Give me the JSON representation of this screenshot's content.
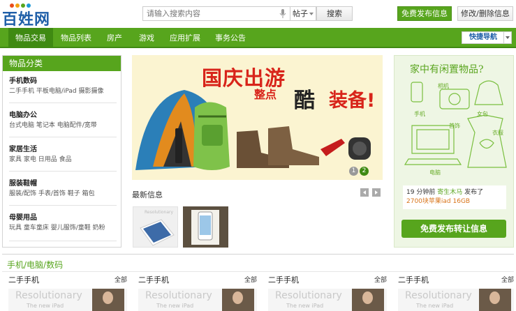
{
  "header": {
    "logo": "百姓网",
    "search_placeholder": "请输入搜索内容",
    "search_scope": "帖子",
    "search_button": "搜索",
    "post_button": "免费发布信息",
    "edit_button": "修改/删除信息"
  },
  "nav": {
    "items": [
      "物品交易",
      "物品列表",
      "房产",
      "游戏",
      "应用扩展",
      "事务公告"
    ],
    "quick_nav": "快捷导航"
  },
  "sidebar": {
    "title": "物品分类",
    "categories": [
      {
        "title": "手机数码",
        "items": "二手手机 平板电脑/iPad 摄影摄像"
      },
      {
        "title": "电脑办公",
        "items": "台式电脑 笔记本 电脑配件/宽带"
      },
      {
        "title": "家居生活",
        "items": "家具 家电 日用品 食品"
      },
      {
        "title": "服装鞋帽",
        "items": "服装/配饰 手表/首饰 鞋子 箱包"
      },
      {
        "title": "母婴用品",
        "items": "玩具 童车童床 婴儿服饰/童鞋 奶粉"
      }
    ]
  },
  "banner": {
    "line1": "国庆出游",
    "line2": "整点",
    "line3": "酷",
    "line4": "装备!",
    "slide_current": "2",
    "slide_other": "1"
  },
  "news": {
    "title": "最新信息"
  },
  "promo": {
    "title": "家中有闲置物品?",
    "labels": [
      "相机",
      "手机",
      "女包",
      "首饰",
      "衣服",
      "电脑"
    ],
    "ticker_time": "19 分钟前",
    "ticker_user": "寄生木马",
    "ticker_action": "发布了",
    "ticker_item": "2700块苹果iad 16GB",
    "button": "免费发布转让信息"
  },
  "section": {
    "title": "手机/电脑/数码",
    "columns": [
      {
        "title": "二手手机",
        "all": "全部"
      },
      {
        "title": "二手手机",
        "all": "全部"
      },
      {
        "title": "二手手机",
        "all": "全部"
      },
      {
        "title": "二手手机",
        "all": "全部"
      }
    ],
    "thumb_brand": "Resolutionary",
    "thumb_sub": "The new iPad"
  },
  "colors": {
    "brand_green": "#57a51d",
    "dark_green": "#3f8a12",
    "logo_blue": "#1f5fa8",
    "banner_red": "#d8241a"
  }
}
